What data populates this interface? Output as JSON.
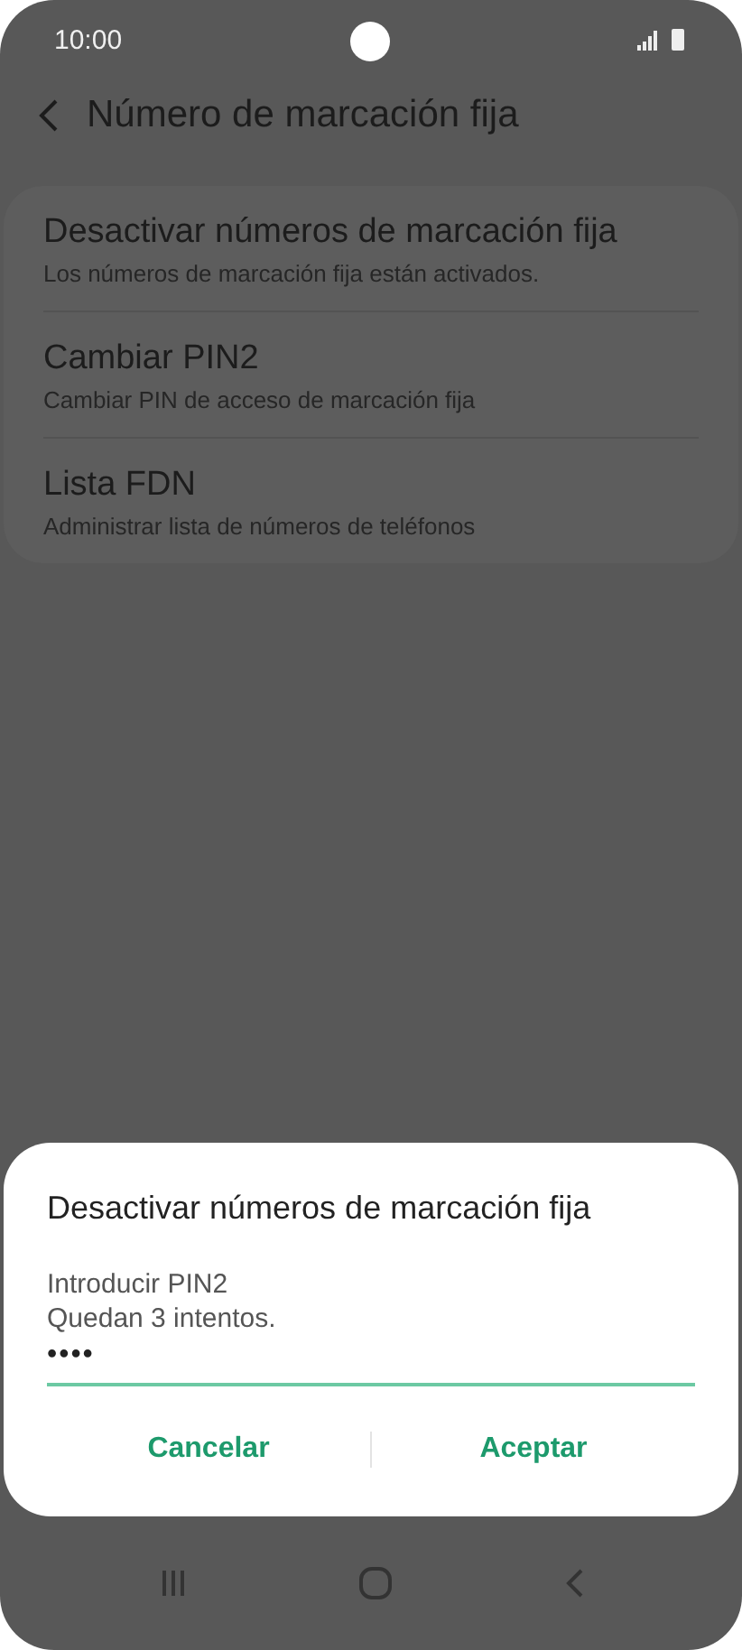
{
  "status_bar": {
    "time": "10:00"
  },
  "header": {
    "title": "Número de marcación fija"
  },
  "settings": [
    {
      "title": "Desactivar números de marcación fija",
      "subtitle": "Los números de marcación fija están activados."
    },
    {
      "title": "Cambiar PIN2",
      "subtitle": "Cambiar PIN de acceso de marcación fija"
    },
    {
      "title": "Lista FDN",
      "subtitle": "Administrar lista de números de teléfonos"
    }
  ],
  "dialog": {
    "title": "Desactivar números de marcación fija",
    "message_lines": [
      "Introducir PIN2",
      "Quedan 3 intentos."
    ],
    "pin_value": "••••",
    "buttons": [
      "Cancelar",
      "Aceptar"
    ]
  }
}
